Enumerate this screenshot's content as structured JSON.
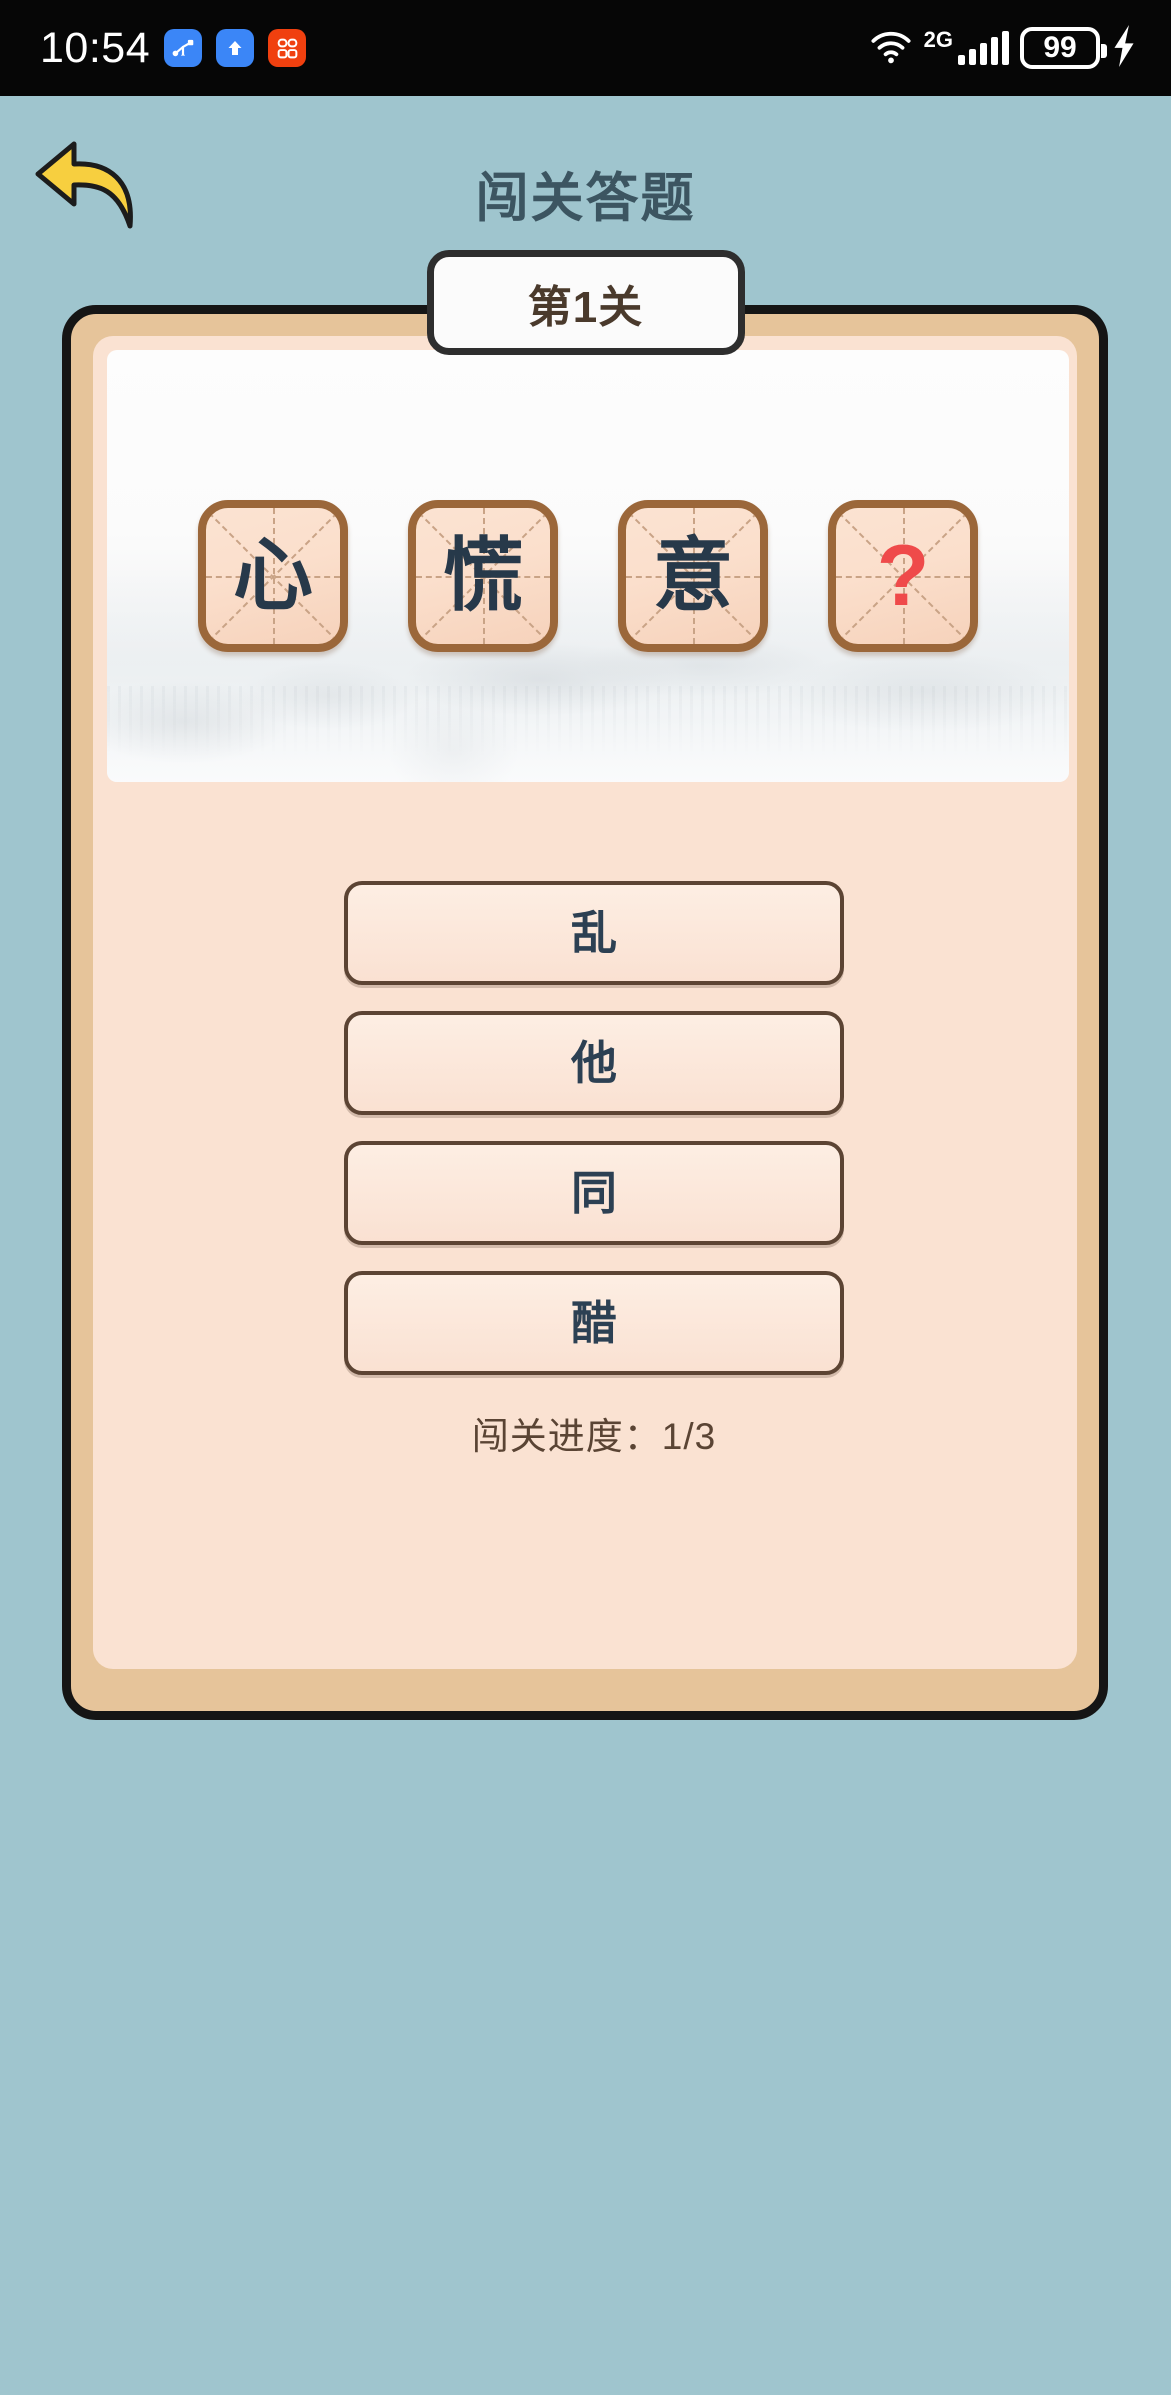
{
  "status_bar": {
    "time": "10:54",
    "tray_icons": [
      "usb-icon",
      "upload-icon",
      "app-badge-icon"
    ],
    "network_type": "2G",
    "battery_level": "99",
    "wifi": "wifi-icon",
    "charging": "charging-bolt-icon"
  },
  "header": {
    "back_label": "back-arrow-icon",
    "title": "闯关答题"
  },
  "level_tab": {
    "label": "第1关"
  },
  "question": {
    "idiom_tiles": [
      {
        "char": "心",
        "state": "revealed"
      },
      {
        "char": "慌",
        "state": "revealed"
      },
      {
        "char": "意",
        "state": "revealed"
      },
      {
        "char": "?",
        "state": "unknown"
      }
    ]
  },
  "options": [
    {
      "label": "乱"
    },
    {
      "label": "他"
    },
    {
      "label": "同"
    },
    {
      "label": "醋"
    }
  ],
  "progress": {
    "text": "闯关进度：1/3",
    "current": "1",
    "total": "3"
  },
  "colors": {
    "background": "#9fc5ce",
    "card_frame": "#e6c49a",
    "card_inner": "#fae2d2",
    "tile_border": "#9b673a",
    "title": "#3c5561",
    "unknown_char": "#ef4a4a",
    "back_arrow": "#f7cf3f"
  }
}
